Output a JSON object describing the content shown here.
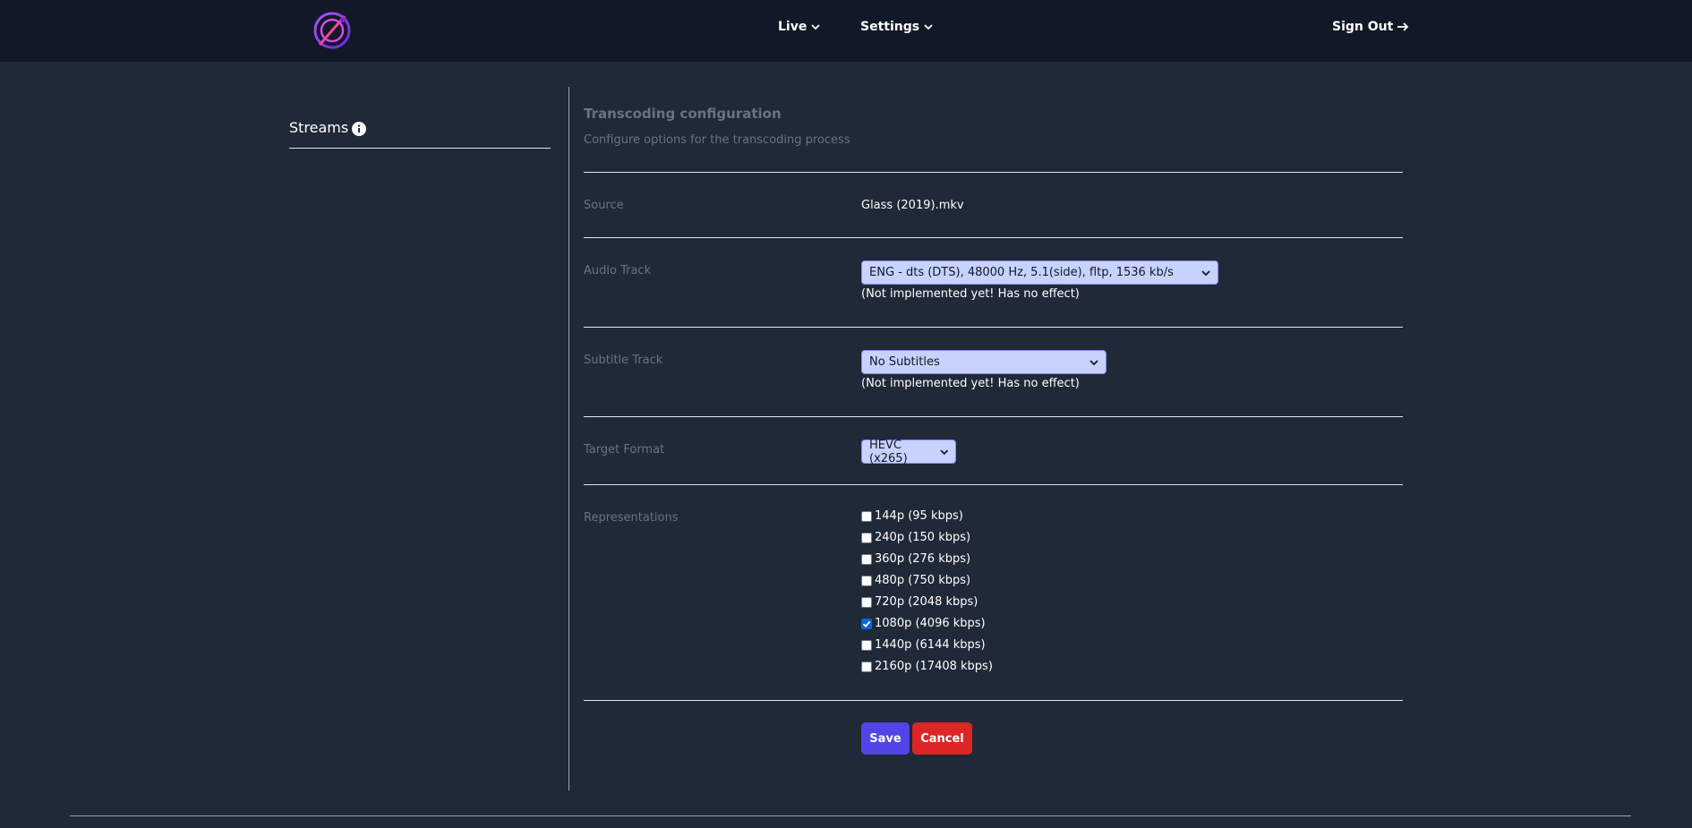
{
  "nav": {
    "live_label": "Live",
    "settings_label": "Settings",
    "signout_label": "Sign Out"
  },
  "sidebar": {
    "title": "Streams"
  },
  "panel": {
    "title": "Transcoding configuration",
    "description": "Configure options for the transcoding process"
  },
  "form": {
    "source": {
      "label": "Source",
      "value": "Glass (2019).mkv"
    },
    "audio": {
      "label": "Audio Track",
      "selected": "ENG - dts (DTS), 48000 Hz, 5.1(side), fltp, 1536 kb/s",
      "note": "(Not implemented yet! Has no effect)"
    },
    "subtitle": {
      "label": "Subtitle Track",
      "selected": "No Subtitles",
      "note": "(Not implemented yet! Has no effect)"
    },
    "target": {
      "label": "Target Format",
      "selected": "HEVC (x265)"
    },
    "representations": {
      "label": "Representations",
      "items": [
        {
          "label": "144p (95 kbps)",
          "checked": false
        },
        {
          "label": "240p (150 kbps)",
          "checked": false
        },
        {
          "label": "360p (276 kbps)",
          "checked": false
        },
        {
          "label": "480p (750 kbps)",
          "checked": false
        },
        {
          "label": "720p (2048 kbps)",
          "checked": false
        },
        {
          "label": "1080p (4096 kbps)",
          "checked": true
        },
        {
          "label": "1440p (6144 kbps)",
          "checked": false
        },
        {
          "label": "2160p (17408 kbps)",
          "checked": false
        }
      ]
    }
  },
  "actions": {
    "save_label": "Save",
    "cancel_label": "Cancel"
  },
  "colors": {
    "background": "#1f2937",
    "navbar": "#111827",
    "select_bg": "#c7d2fe",
    "save": "#4f46e5",
    "cancel": "#dc2626"
  }
}
